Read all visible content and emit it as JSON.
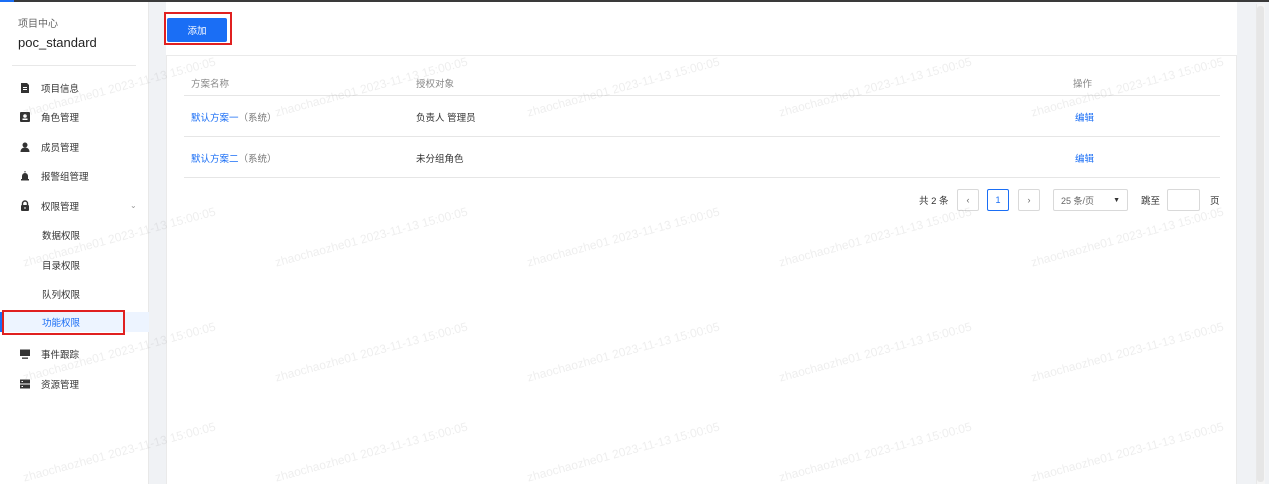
{
  "sidebar": {
    "caption": "项目中心",
    "project_name": "poc_standard",
    "items": [
      {
        "label": "项目信息",
        "icon": "document-icon"
      },
      {
        "label": "角色管理",
        "icon": "id-card-icon"
      },
      {
        "label": "成员管理",
        "icon": "user-icon"
      },
      {
        "label": "报警组管理",
        "icon": "alarm-icon"
      },
      {
        "label": "权限管理",
        "icon": "lock-icon",
        "expanded": true,
        "children": [
          "数据权限",
          "目录权限",
          "队列权限",
          "功能权限"
        ],
        "active_child": "功能权限"
      },
      {
        "label": "事件跟踪",
        "icon": "monitor-icon"
      },
      {
        "label": "资源管理",
        "icon": "server-icon"
      }
    ]
  },
  "toolbar": {
    "add_label": "添加"
  },
  "table": {
    "columns": [
      "方案名称",
      "授权对象",
      "操作"
    ],
    "rows": [
      {
        "name": "默认方案一",
        "tag": "（系统）",
        "target": "负责人 管理员",
        "action": "编辑"
      },
      {
        "name": "默认方案二",
        "tag": "（系统）",
        "target": "未分组角色",
        "action": "编辑"
      }
    ]
  },
  "pagination": {
    "total": "共 2 条",
    "prev": "‹",
    "current_page": "1",
    "next": "›",
    "page_size": "25 条/页",
    "jump_label": "跳至",
    "jump_value": "",
    "page_suffix": "页"
  },
  "watermark": "zhaochaozhe01 2023-11-13 15:00:05",
  "colors": {
    "accent": "#1a6ef5",
    "highlight": "#e02020"
  }
}
